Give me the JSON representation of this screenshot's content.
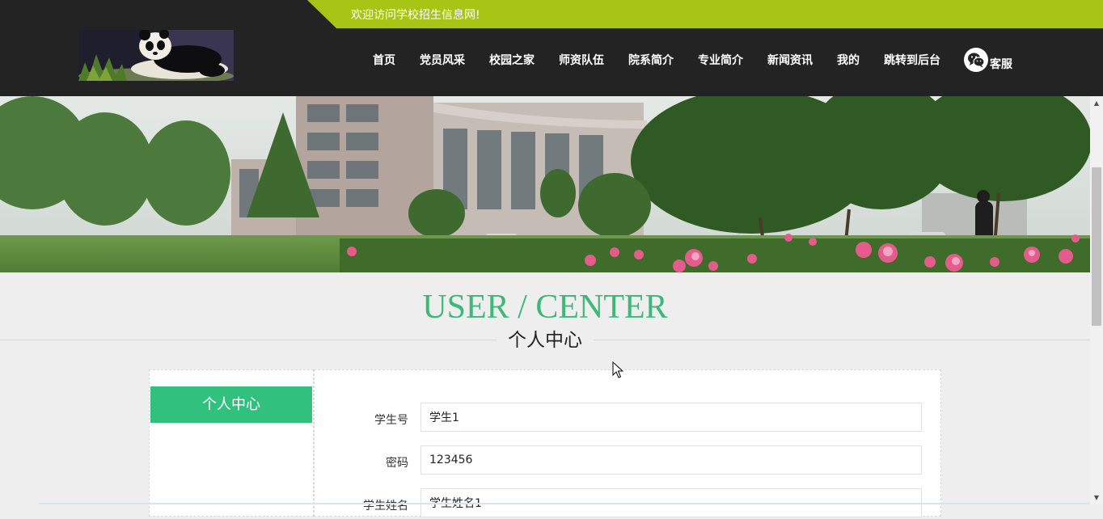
{
  "header": {
    "welcome_text": "欢迎访问学校招生信息网!",
    "nav_items": [
      "首页",
      "党员风采",
      "校园之家",
      "师资队伍",
      "院系简介",
      "专业简介",
      "新闻资讯",
      "我的",
      "跳转到后台"
    ],
    "service_label": "客服"
  },
  "section": {
    "title_en": "USER / CENTER",
    "title_cn": "个人中心"
  },
  "sidebar": {
    "active_item": "个人中心"
  },
  "form": {
    "fields": [
      {
        "label": "学生号",
        "value": "学生1"
      },
      {
        "label": "密码",
        "value": "123456"
      },
      {
        "label": "学生姓名",
        "value": "学生姓名1"
      }
    ]
  },
  "colors": {
    "accent_green": "#32c07e",
    "title_green": "#3cb878",
    "welcome_bar": "#a8c414",
    "header_bg": "#232323"
  },
  "icons": {
    "service": "wechat-icon",
    "scroll_up": "triangle-up-icon",
    "scroll_down": "triangle-down-icon"
  }
}
